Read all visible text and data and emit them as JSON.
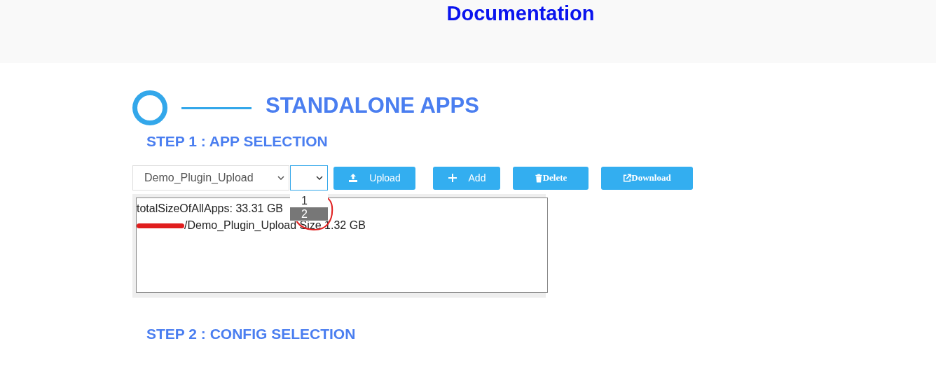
{
  "header": {
    "title": "Documentation"
  },
  "section": {
    "title": "STANDALONE APPS"
  },
  "step1": {
    "title": "STEP 1 : APP SELECTION",
    "app_select": {
      "value": "Demo_Plugin_Upload"
    },
    "version_select": {
      "options": [
        {
          "label": "1",
          "selected": false
        },
        {
          "label": "2",
          "selected": true
        }
      ]
    },
    "buttons": [
      {
        "kind": "upload",
        "label": "Upload"
      },
      {
        "kind": "add",
        "label": "Add"
      },
      {
        "kind": "delete",
        "label": "Delete"
      },
      {
        "kind": "download",
        "label": "Download"
      }
    ],
    "output_lines": [
      {
        "text": "totalSizeOfAllApps: 33.31 GB",
        "redacted": false
      },
      {
        "text": "/Demo_Plugin_Upload Size  1.32 GB",
        "redacted": true
      }
    ]
  },
  "step2": {
    "title": "STEP 2 : CONFIG SELECTION"
  }
}
